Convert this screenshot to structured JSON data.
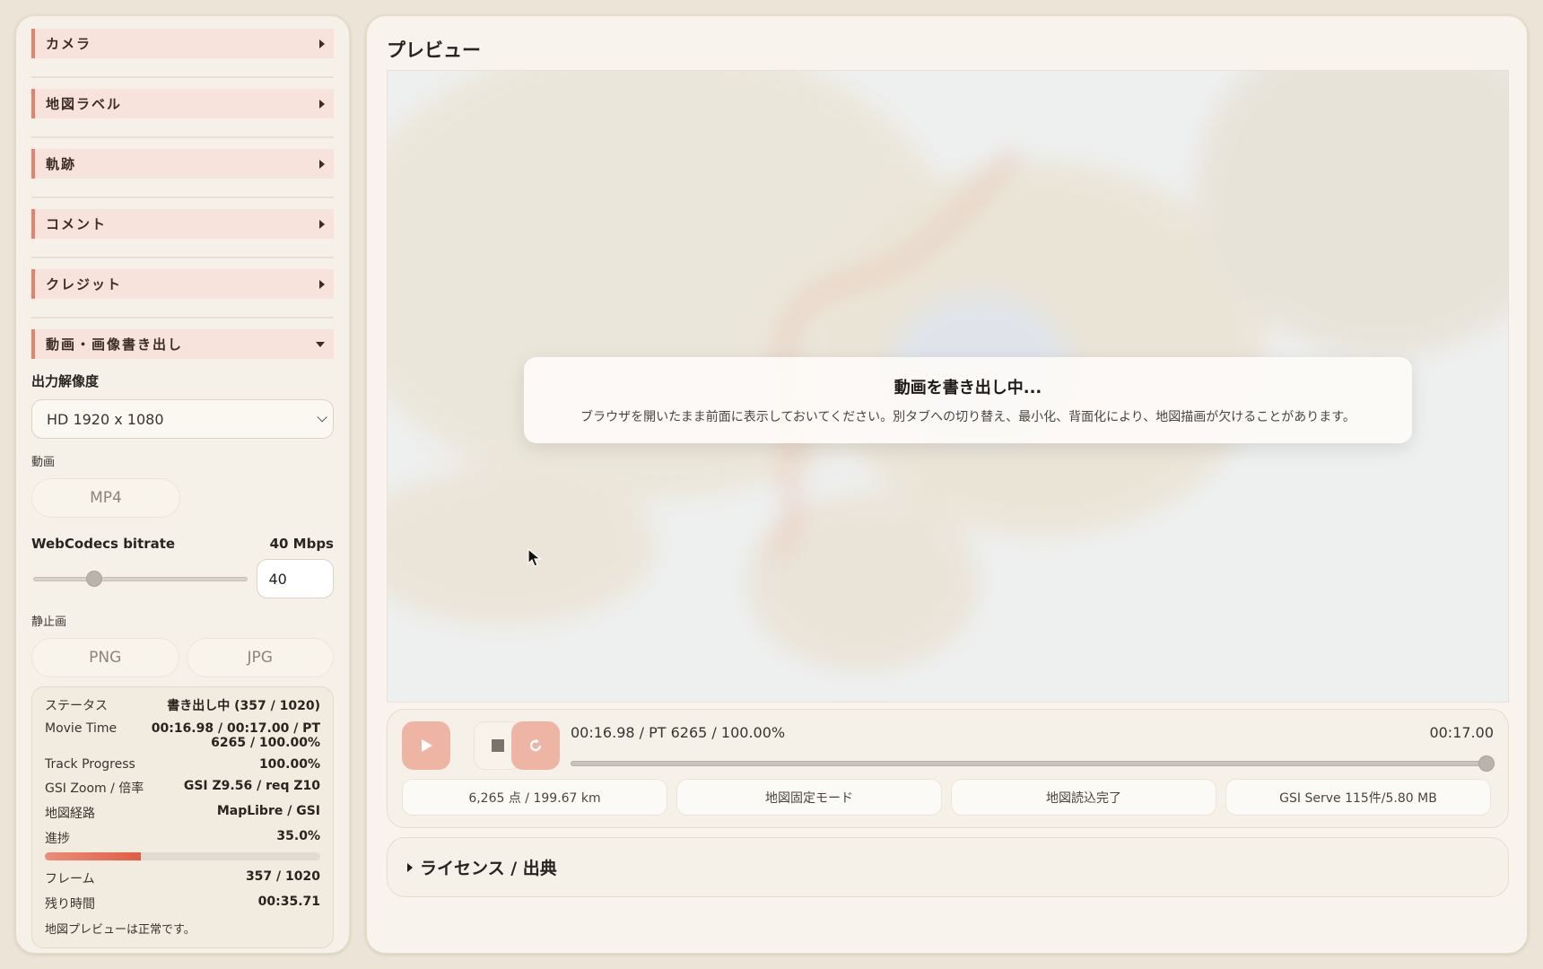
{
  "sidebar": {
    "sections": [
      {
        "label": "カメラ"
      },
      {
        "label": "地図ラベル"
      },
      {
        "label": "軌跡"
      },
      {
        "label": "コメント"
      },
      {
        "label": "クレジット"
      }
    ],
    "export": {
      "label": "動画・画像書き出し",
      "resolution_label": "出力解像度",
      "resolution_value": "HD 1920 x 1080",
      "video_label": "動画",
      "video_format": "MP4",
      "bitrate_label": "WebCodecs bitrate",
      "bitrate_value_text": "40 Mbps",
      "bitrate_input": "40",
      "bitrate_slider_fraction": 0.27,
      "still_label": "静止画",
      "still_formats": [
        "PNG",
        "JPG"
      ]
    },
    "status": {
      "status_label": "ステータス",
      "status_value": "書き出し中 (357 / 1020)",
      "movie_time_label": "Movie Time",
      "movie_time_value_line1": "00:16.98 / 00:17.00 / PT",
      "movie_time_value_line2": "6265 / 100.00%",
      "track_progress_label": "Track Progress",
      "track_progress_value": "100.00%",
      "gsi_zoom_label": "GSI Zoom / 倍率",
      "gsi_zoom_value": "GSI Z9.56 / req Z10",
      "route_label": "地図経路",
      "route_value": "MapLibre / GSI",
      "progress_label": "進捗",
      "progress_value": "35.0%",
      "progress_fraction": 0.35,
      "frame_label": "フレーム",
      "frame_value": "357 / 1020",
      "remaining_label": "残り時間",
      "remaining_value": "00:35.71",
      "note": "地図プレビューは正常です。"
    }
  },
  "main": {
    "title": "プレビュー",
    "modal": {
      "title": "動画を書き出し中...",
      "message": "ブラウザを開いたまま前面に表示しておいてください。別タブへの切り替え、最小化、背面化により、地図描画が欠けることがあります。"
    },
    "player": {
      "time_left": "00:16.98 / PT 6265 / 100.00%",
      "time_right": "00:17.00",
      "seek_fraction": 1.0,
      "chips": [
        "6,265 点 / 199.67 km",
        "地図固定モード",
        "地図読込完了",
        "GSI Serve 115件/5.80 MB"
      ]
    },
    "license_label": "ライセンス / 出典"
  },
  "colors": {
    "accent": "#e8806a",
    "section_bg": "#f8e3dc",
    "play_button": "#efb5a4"
  },
  "icons": {
    "play": "play-icon",
    "stop": "stop-icon",
    "refresh": "refresh-icon"
  }
}
